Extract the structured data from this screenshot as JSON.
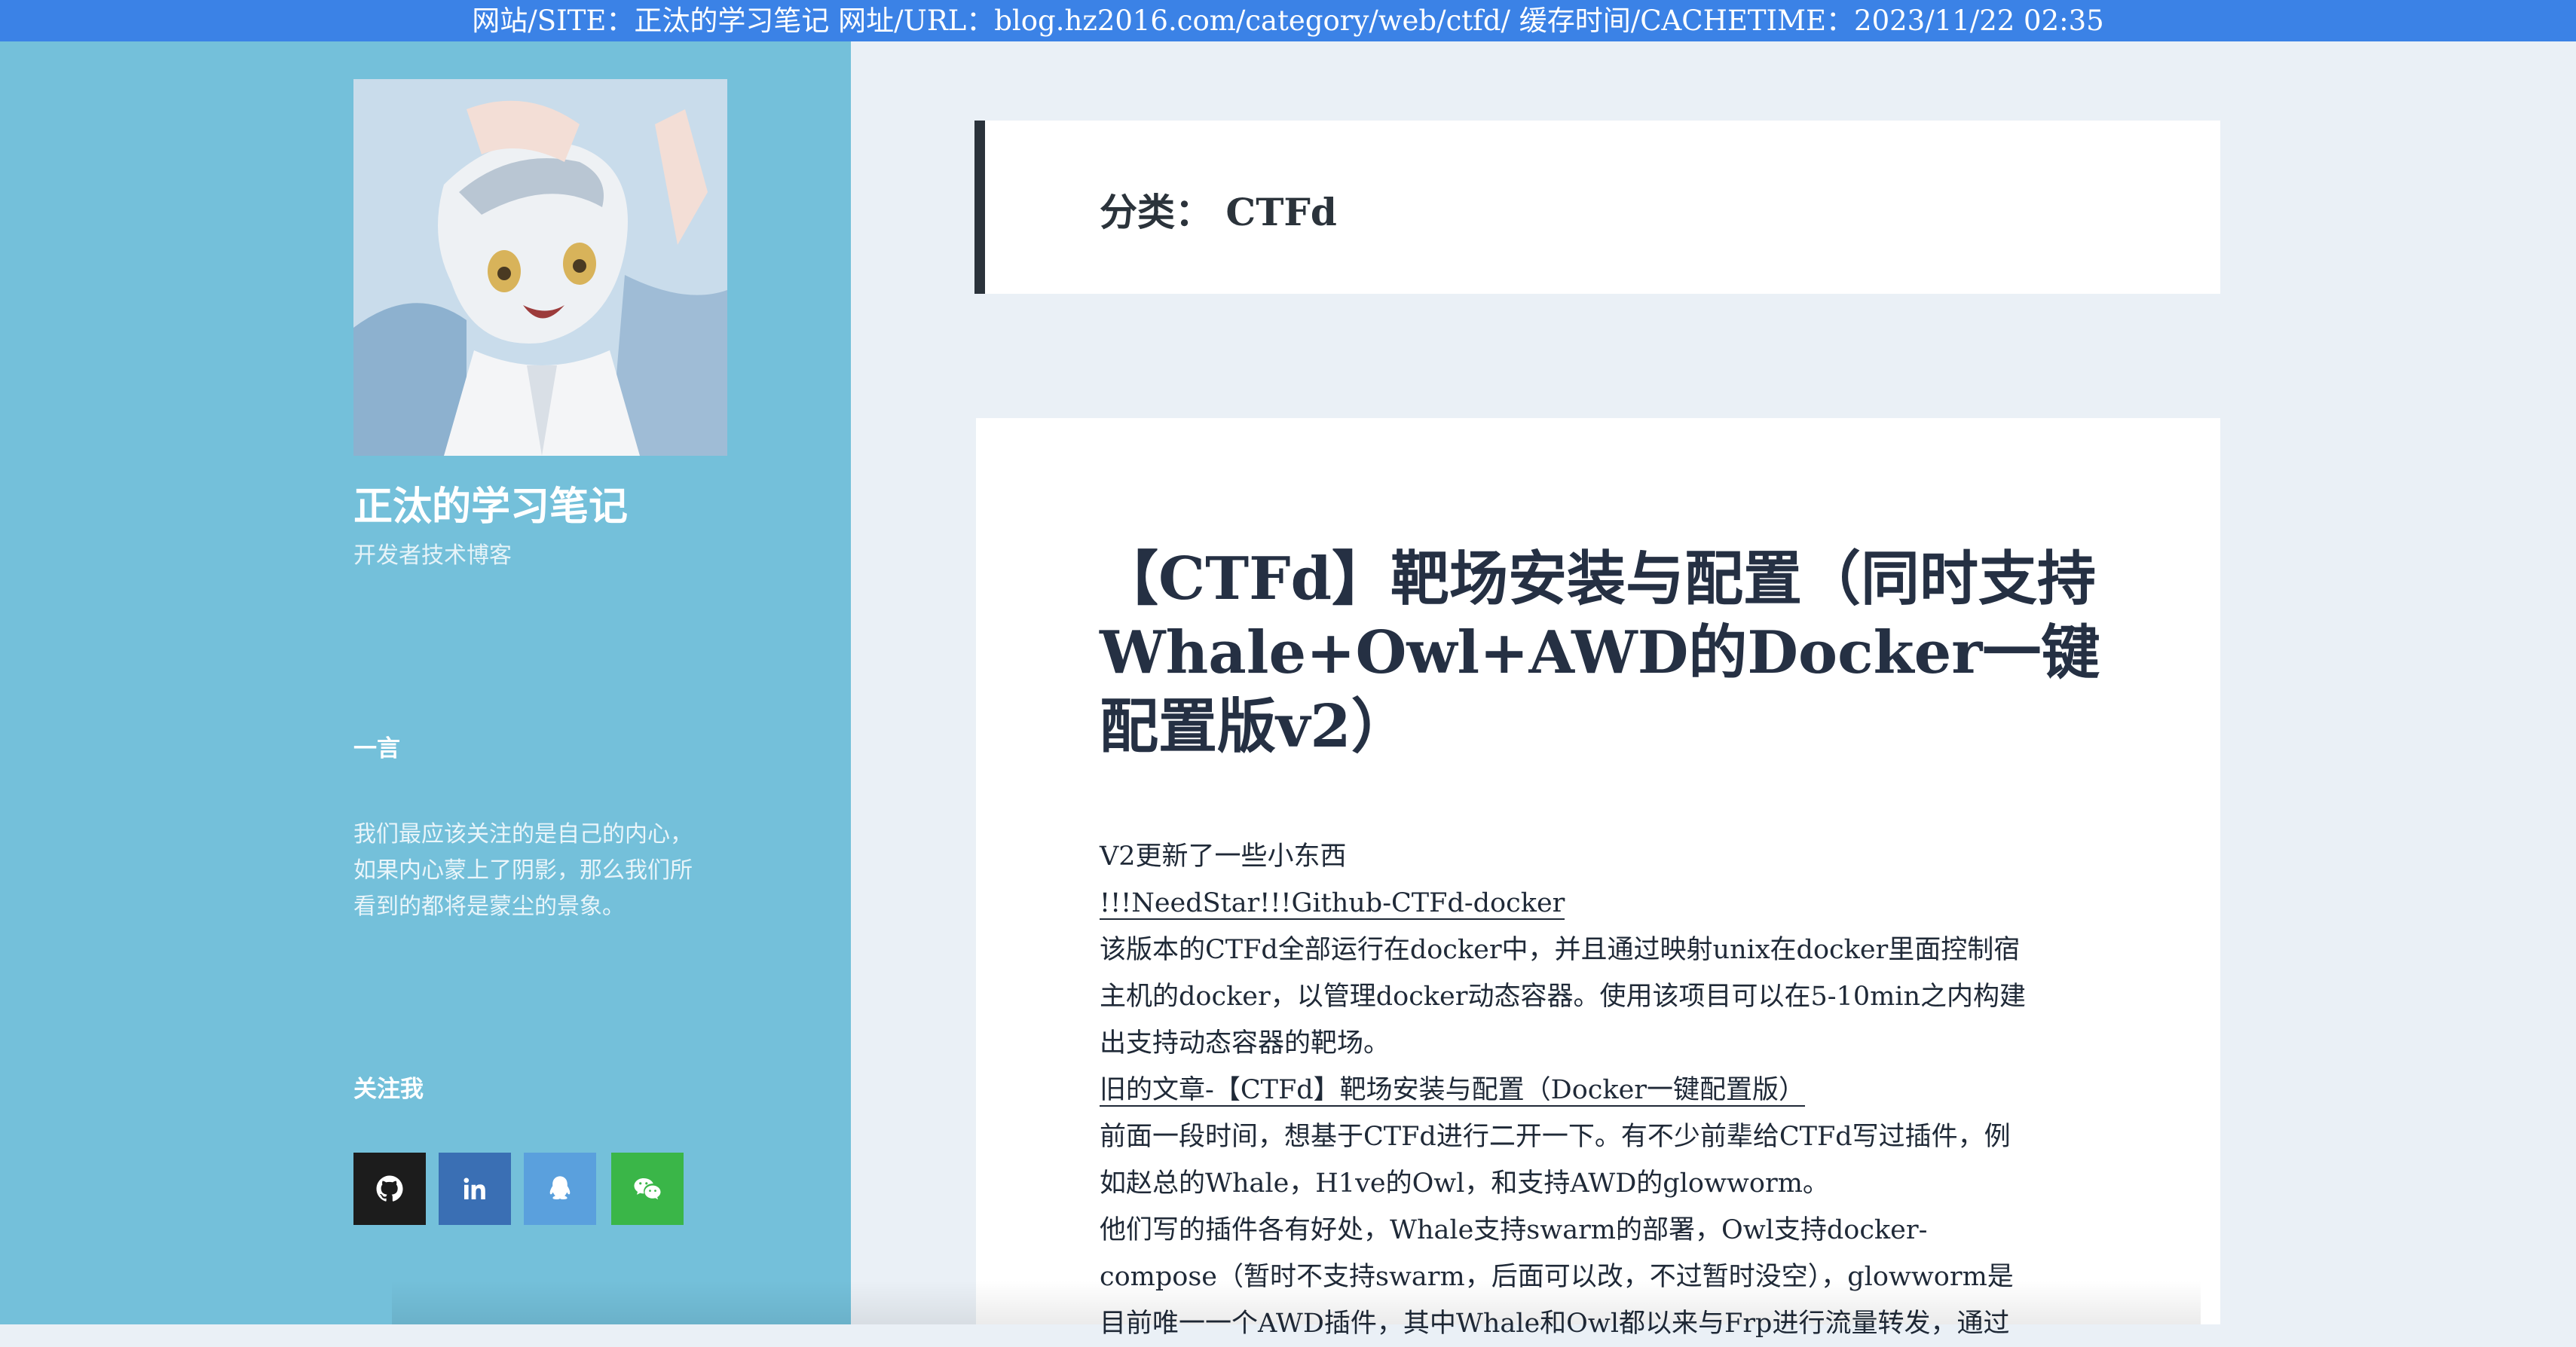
{
  "banner": {
    "text": "网站/SITE：正汰的学习笔记 网址/URL：blog.hz2016.com/category/web/ctfd/ 缓存时间/CACHETIME：2023/11/22 02:35"
  },
  "sidebar": {
    "site_title": "正汰的学习笔记",
    "site_description": "开发者技术博客",
    "yiyan_title": "一言",
    "quote_lines": [
      "我们最应该关注的是自己的内心，",
      "如果内心蒙上了阴影，那么我们所",
      "看到的都将是蒙尘的景象。"
    ],
    "follow_title": "关注我",
    "social": [
      "github-icon",
      "linkedin-icon",
      "qq-icon",
      "wechat-icon"
    ]
  },
  "category": {
    "label": "分类： CTFd"
  },
  "article": {
    "title": "【CTFd】靶场安装与配置（同时支持Whale+Owl+AWD的Docker一键配置版v2）",
    "lines": [
      "V2更新了一些小东西",
      "!!!NeedStar!!!Github-CTFd-docker",
      "该版本的CTFd全部运行在docker中，并且通过映射unix在docker里面控制宿",
      "主机的docker，以管理docker动态容器。使用该项目可以在5-10min之内构建",
      "出支持动态容器的靶场。",
      "旧的文章-【CTFd】靶场安装与配置（Docker一键配置版）",
      "前面一段时间，想基于CTFd进行二开一下。有不少前辈给CTFd写过插件，例",
      "如赵总的Whale，H1ve的Owl，和支持AWD的glowworm。",
      "他们写的插件各有好处，Whale支持swarm的部署，Owl支持docker-",
      "compose（暂时不支持swarm，后面可以改，不过暂时没空），glowworm是",
      "目前唯一一个AWD插件，其中Whale和Owl都以来与Frp进行流量转发，通过"
    ]
  }
}
